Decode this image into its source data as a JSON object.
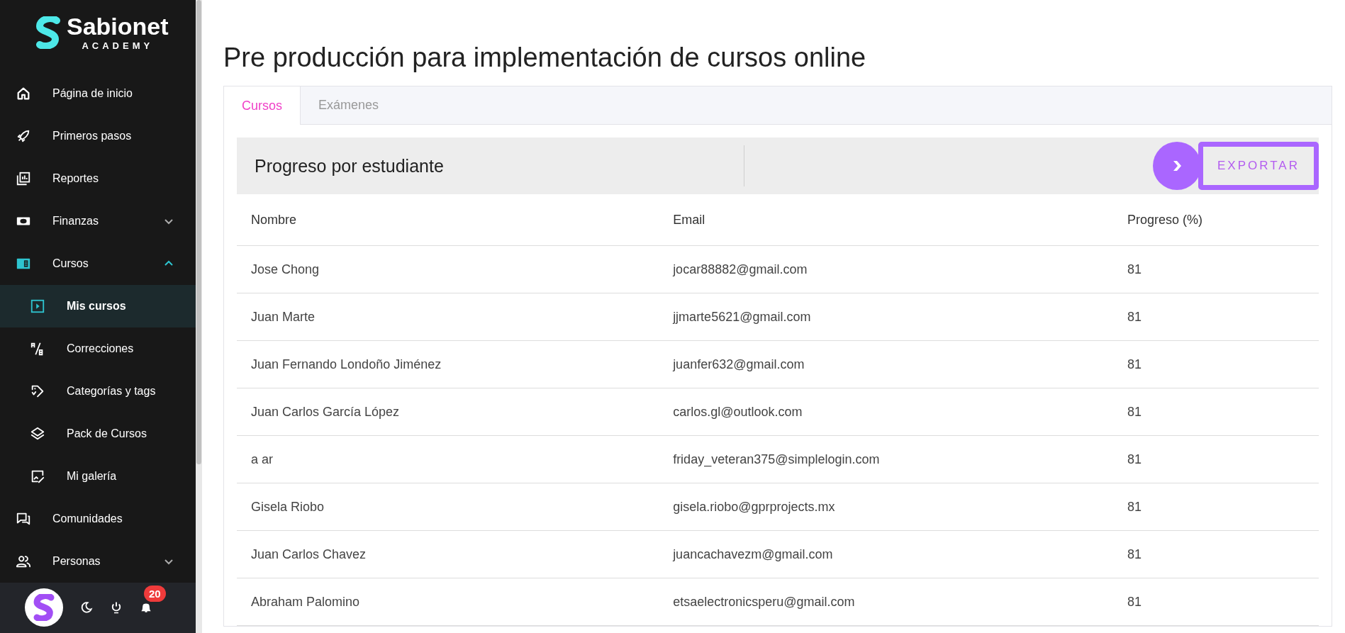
{
  "sidebar": {
    "logo": {
      "name": "Sabionet",
      "tagline": "ACADEMY"
    },
    "items": [
      {
        "label": "Página de inicio",
        "selected": false
      },
      {
        "label": "Primeros pasos",
        "selected": false
      },
      {
        "label": "Reportes",
        "selected": false
      },
      {
        "label": "Finanzas",
        "selected": false,
        "expanded": false
      },
      {
        "label": "Cursos",
        "selected": false,
        "expanded": true,
        "children": [
          {
            "label": "Mis cursos",
            "selected": true
          },
          {
            "label": "Correcciones",
            "selected": false
          },
          {
            "label": "Categorías y tags",
            "selected": false
          },
          {
            "label": "Pack de Cursos",
            "selected": false
          },
          {
            "label": "Mi galería",
            "selected": false
          }
        ]
      },
      {
        "label": "Comunidades",
        "selected": false
      },
      {
        "label": "Personas",
        "selected": false,
        "expanded": false
      }
    ],
    "notifications_badge": "20"
  },
  "page_title": "Pre producción para implementación de cursos online",
  "tabs": [
    {
      "label": "Cursos",
      "selected": true
    },
    {
      "label": "Exámenes",
      "selected": false
    }
  ],
  "section": {
    "title": "Progreso por estudiante",
    "export_button": "EXPORTAR"
  },
  "table": {
    "columns": [
      "Nombre",
      "Email",
      "Progreso (%)"
    ],
    "rows": [
      [
        "Jose Chong",
        "jocar88882@gmail.com",
        "81"
      ],
      [
        "Juan Marte",
        "jjmarte5621@gmail.com",
        "81"
      ],
      [
        "Juan Fernando Londoño Jiménez",
        "juanfer632@gmail.com",
        "81"
      ],
      [
        "Juan Carlos García López",
        "carlos.gl@outlook.com",
        "81"
      ],
      [
        "a ar",
        "friday_veteran375@simplelogin.com",
        "81"
      ],
      [
        "Gisela Riobo",
        "gisela.riobo@gprprojects.mx",
        "81"
      ],
      [
        "Juan Carlos Chavez",
        "juancachavezm@gmail.com",
        "81"
      ],
      [
        "Abraham Palomino",
        "etsaelectronicsperu@gmail.com",
        "81"
      ]
    ]
  }
}
